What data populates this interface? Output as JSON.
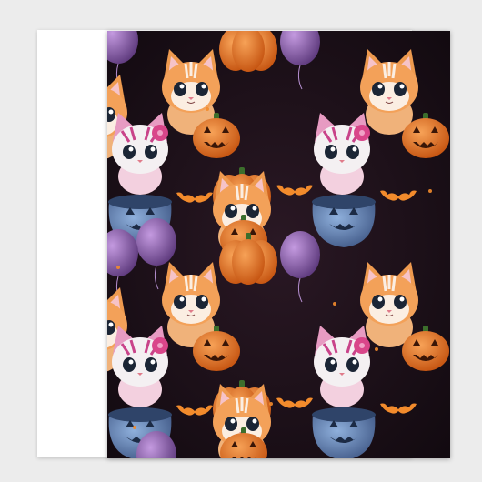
{
  "product": {
    "pattern_name": "halloween-kitten-pattern",
    "colors": {
      "background": "#1a1016",
      "orange": "#e8853a",
      "pumpkin": "#e06a1e",
      "pink": "#e79bc2",
      "blue": "#5f7fb0",
      "purple": "#7c5a9c"
    },
    "motifs": [
      "orange-kitten-icon",
      "pink-kitten-icon",
      "pumpkin-icon",
      "jack-o-lantern-icon",
      "blue-cauldron-icon",
      "balloon-icon",
      "bat-icon"
    ]
  }
}
